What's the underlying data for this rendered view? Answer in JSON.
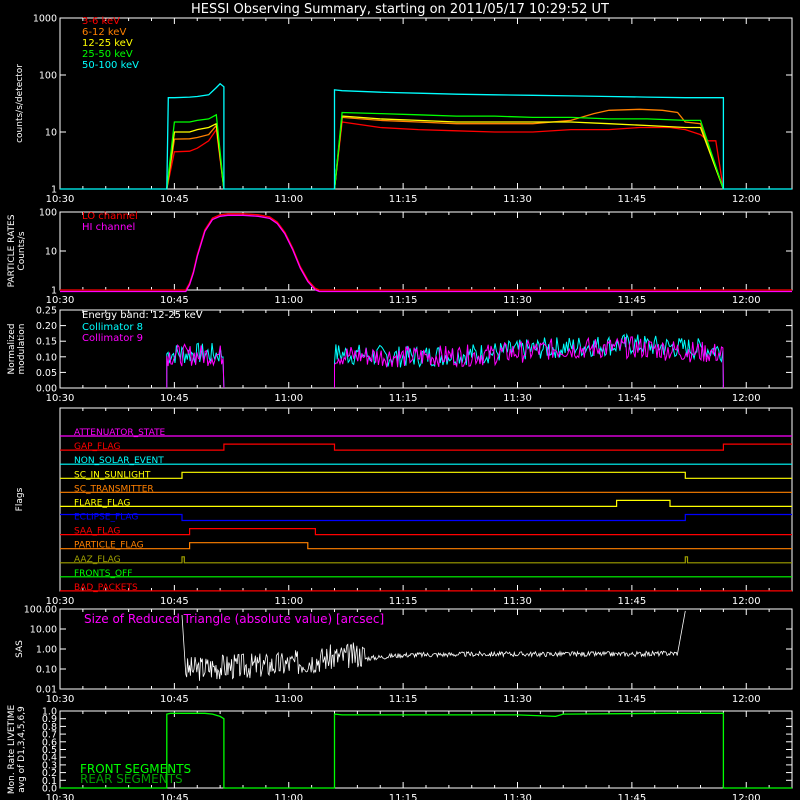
{
  "title": "HESSI Observing Summary, starting on 2011/05/17 10:29:52 UT",
  "time_ticks": [
    "10:30",
    "10:45",
    "11:00",
    "11:15",
    "11:30",
    "11:45",
    "12:00"
  ],
  "colors": {
    "background": "#000000",
    "axes": "#ffffff",
    "red": "#ff0000",
    "orange": "#ff8000",
    "yellow": "#ffff00",
    "green": "#00ff00",
    "cyan": "#00ffff",
    "magenta": "#ff00ff",
    "blue": "#0000ff",
    "olive": "#a0a000",
    "darkgreen": "#00a000",
    "white": "#ffffff"
  },
  "chart_data": [
    {
      "type": "line",
      "id": "count-rates",
      "ylabel": "counts/s/detector",
      "yscale": "log",
      "ylim": [
        1,
        1000
      ],
      "yticks": [
        "1",
        "10",
        "100",
        "1000"
      ],
      "xlim_minutes": [
        0,
        96
      ],
      "legend_placement": "top-left",
      "series": [
        {
          "name": "3-6 keV",
          "color": "red",
          "segments": [
            {
              "x": [
                14,
                15,
                17,
                18,
                19.5,
                20.5,
                21.5
              ],
              "y": [
                1,
                4.5,
                4.6,
                5.2,
                7,
                11,
                1
              ]
            },
            {
              "x": [
                36,
                37,
                42,
                47,
                52,
                57,
                62,
                67,
                72,
                76,
                80,
                82,
                84,
                85,
                86,
                87
              ],
              "y": [
                1,
                15,
                12,
                11,
                10.5,
                10,
                10,
                11,
                11,
                12,
                12,
                11,
                9,
                7,
                7,
                1
              ]
            }
          ]
        },
        {
          "name": "6-12 keV",
          "color": "orange",
          "segments": [
            {
              "x": [
                14,
                15,
                17,
                18,
                19.5,
                20.5,
                21.5
              ],
              "y": [
                1,
                7.5,
                7.6,
                8,
                9,
                13,
                1
              ]
            },
            {
              "x": [
                36,
                37,
                42,
                47,
                52,
                57,
                62,
                67,
                70,
                72,
                76,
                79,
                81,
                82,
                84,
                87
              ],
              "y": [
                1,
                18,
                16,
                15,
                14,
                14,
                14,
                16,
                21,
                24,
                25,
                24,
                22,
                15,
                14,
                1
              ]
            }
          ]
        },
        {
          "name": "12-25 keV",
          "color": "yellow",
          "segments": [
            {
              "x": [
                14,
                15,
                17,
                18,
                19.5,
                20.5,
                21.5
              ],
              "y": [
                1,
                10,
                10,
                11,
                12,
                14,
                1
              ]
            },
            {
              "x": [
                36,
                37,
                42,
                47,
                52,
                57,
                62,
                67,
                72,
                77,
                82,
                84,
                87
              ],
              "y": [
                1,
                19,
                17,
                16,
                15,
                15,
                15,
                15,
                14,
                13,
                12,
                12,
                1
              ]
            }
          ]
        },
        {
          "name": "25-50 keV",
          "color": "green",
          "segments": [
            {
              "x": [
                14,
                15,
                17,
                18,
                19.5,
                20.5,
                21.5
              ],
              "y": [
                1,
                15,
                15,
                16,
                17,
                20,
                1
              ]
            },
            {
              "x": [
                36,
                37,
                42,
                47,
                52,
                57,
                62,
                67,
                72,
                77,
                82,
                84,
                87
              ],
              "y": [
                1,
                22,
                21,
                20,
                19,
                19,
                18,
                18,
                17,
                17,
                16,
                16,
                1
              ]
            }
          ]
        },
        {
          "name": "50-100 keV",
          "color": "cyan",
          "segments": [
            {
              "x": [
                0,
                14,
                14.2,
                15,
                17,
                18,
                19.5,
                20.5,
                21,
                21.5,
                21.5,
                36,
                36,
                37,
                42,
                47,
                52,
                57,
                62,
                67,
                72,
                77,
                82,
                87,
                87,
                96
              ],
              "y": [
                1,
                1,
                40,
                40,
                41,
                42,
                45,
                60,
                70,
                62,
                1,
                1,
                55,
                53,
                50,
                48,
                46,
                45,
                44,
                43,
                42,
                41,
                40,
                40,
                1,
                1
              ]
            }
          ]
        }
      ]
    },
    {
      "type": "line",
      "id": "particle-rates",
      "ylabel_lines": [
        "PARTICLE RATES",
        "Counts/s"
      ],
      "yscale": "log",
      "ylim": [
        1,
        100
      ],
      "yticks": [
        "1",
        "10",
        "100"
      ],
      "legend_placement": "top-left",
      "series": [
        {
          "name": "LO channel",
          "color": "red",
          "x": [
            0,
            16.5,
            17,
            17.5,
            18,
            19,
            20,
            21,
            22,
            24,
            26,
            27.5,
            28.5,
            29.5,
            30.5,
            31.5,
            32.5,
            33.5,
            34,
            96
          ],
          "y": [
            1,
            1,
            1.5,
            3,
            8,
            35,
            70,
            85,
            90,
            90,
            85,
            75,
            55,
            30,
            12,
            4,
            1.8,
            1.1,
            1,
            1
          ]
        },
        {
          "name": "HI channel",
          "color": "magenta",
          "x": [
            0,
            16.5,
            17,
            17.5,
            18,
            19,
            20,
            21,
            22,
            24,
            26,
            27.5,
            28.5,
            29.5,
            30.5,
            31.5,
            32.5,
            33.5,
            34,
            96
          ],
          "y": [
            1,
            1,
            1.5,
            3,
            8,
            35,
            70,
            85,
            90,
            90,
            85,
            75,
            55,
            30,
            12,
            4,
            1.8,
            1.1,
            1,
            1
          ]
        }
      ]
    },
    {
      "type": "line",
      "id": "modulation",
      "ylabel_lines": [
        "Normalized",
        "modulation"
      ],
      "ylim": [
        0,
        0.25
      ],
      "yticks": [
        "0.00",
        "0.05",
        "0.10",
        "0.15",
        "0.20",
        "0.25"
      ],
      "annotation": "Energy band: 12-25 keV",
      "legend_placement": "top-left",
      "series": [
        {
          "name": "Collimator 8",
          "color": "cyan",
          "segments": [
            {
              "x": [
                14,
                21.5
              ],
              "y": [
                0.11,
                0.11
              ]
            },
            {
              "x": [
                36,
                45,
                55,
                65,
                75,
                87
              ],
              "y": [
                0.11,
                0.1,
                0.11,
                0.13,
                0.14,
                0.12
              ]
            }
          ]
        },
        {
          "name": "Collimator 9",
          "color": "magenta",
          "segments": [
            {
              "x": [
                14,
                21.5
              ],
              "y": [
                0.105,
                0.105
              ]
            },
            {
              "x": [
                36,
                45,
                55,
                65,
                75,
                87
              ],
              "y": [
                0.105,
                0.1,
                0.105,
                0.125,
                0.13,
                0.11
              ]
            }
          ]
        }
      ]
    },
    {
      "type": "line",
      "id": "flags",
      "ylabel": "Flags",
      "flags": [
        {
          "name": "ATTENUATOR_STATE",
          "color": "magenta",
          "x": [
            0,
            96
          ],
          "on": [
            0,
            0
          ]
        },
        {
          "name": "GAP_FLAG",
          "color": "red",
          "x": [
            0,
            21.5,
            21.5,
            36,
            36,
            87,
            87,
            96
          ],
          "on": [
            0,
            0,
            1,
            1,
            0,
            0,
            1,
            1
          ]
        },
        {
          "name": "NON_SOLAR_EVENT",
          "color": "cyan",
          "x": [
            0,
            96
          ],
          "on": [
            0,
            0
          ]
        },
        {
          "name": "SC_IN_SUNLIGHT",
          "color": "yellow",
          "x": [
            0,
            16,
            16,
            82,
            82,
            96
          ],
          "on": [
            0,
            0,
            1,
            1,
            0,
            0
          ]
        },
        {
          "name": "SC_TRANSMITTER",
          "color": "orange",
          "x": [
            0,
            96
          ],
          "on": [
            0,
            0
          ]
        },
        {
          "name": "FLARE_FLAG",
          "color": "yellow",
          "x": [
            0,
            73,
            73,
            80,
            80,
            96
          ],
          "on": [
            0,
            0,
            1,
            1,
            0,
            0
          ]
        },
        {
          "name": "ECLIPSE_FLAG",
          "color": "blue",
          "x": [
            0,
            16,
            16,
            82,
            82,
            96
          ],
          "on": [
            1,
            1,
            0,
            0,
            1,
            1
          ]
        },
        {
          "name": "SAA_FLAG",
          "color": "red",
          "x": [
            0,
            17,
            17,
            33.5,
            33.5,
            96
          ],
          "on": [
            0,
            0,
            1,
            1,
            0,
            0
          ]
        },
        {
          "name": "PARTICLE_FLAG",
          "color": "orange",
          "x": [
            0,
            17,
            17,
            32.5,
            32.5,
            96
          ],
          "on": [
            0,
            0,
            1,
            1,
            0,
            0
          ]
        },
        {
          "name": "AAZ_FLAG",
          "color": "olive",
          "x": [
            0,
            16,
            16,
            16.3,
            16.3,
            82,
            82,
            82.3,
            82.3,
            96
          ],
          "on": [
            0,
            0,
            1,
            1,
            0,
            0,
            1,
            1,
            0,
            0
          ]
        },
        {
          "name": "FRONTS_OFF",
          "color": "green",
          "x": [
            0,
            96
          ],
          "on": [
            0,
            0
          ]
        },
        {
          "name": "BAD_PACKETS",
          "color": "red",
          "x": [
            0,
            96
          ],
          "on": [
            0,
            0
          ]
        }
      ]
    },
    {
      "type": "line",
      "id": "sas",
      "ylabel": "SAS",
      "yscale": "log",
      "ylim": [
        0.01,
        100
      ],
      "yticks": [
        "0.01",
        "0.10",
        "1.00",
        "10.00",
        "100.00"
      ],
      "annotation": "Size of Reduced Triangle (absolute value) [arcsec]",
      "series": [
        {
          "color": "white",
          "x": [
            16,
            16.5,
            20,
            25,
            30,
            35,
            40,
            45,
            55,
            65,
            75,
            81,
            82
          ],
          "y": [
            50,
            0.05,
            0.07,
            0.08,
            0.1,
            0.2,
            0.3,
            0.45,
            0.5,
            0.5,
            0.5,
            0.55,
            80
          ]
        }
      ]
    },
    {
      "type": "line",
      "id": "livetime",
      "ylabel_lines": [
        "Mon. Rate LIVETIME",
        "avg of D1,3,4,5,6,9"
      ],
      "ylim": [
        0,
        1.0
      ],
      "yticks": [
        "0.0",
        "0.1",
        "0.2",
        "0.3",
        "0.4",
        "0.5",
        "0.6",
        "0.7",
        "0.8",
        "0.9",
        "1.0"
      ],
      "legend_placement": "bottom-left",
      "series": [
        {
          "name": "FRONT SEGMENTS",
          "color": "green",
          "x": [
            0,
            14,
            14,
            14.5,
            19,
            20,
            21,
            21.5,
            21.5,
            36,
            36,
            37,
            40,
            50,
            60,
            65,
            66,
            80,
            87,
            87,
            96
          ],
          "y": [
            0,
            0,
            0.96,
            0.97,
            0.97,
            0.96,
            0.93,
            0.9,
            0,
            0,
            0.96,
            0.95,
            0.95,
            0.95,
            0.95,
            0.93,
            0.96,
            0.97,
            0.97,
            0,
            0
          ]
        },
        {
          "name": "REAR SEGMENTS",
          "color": "darkgreen"
        }
      ]
    }
  ]
}
